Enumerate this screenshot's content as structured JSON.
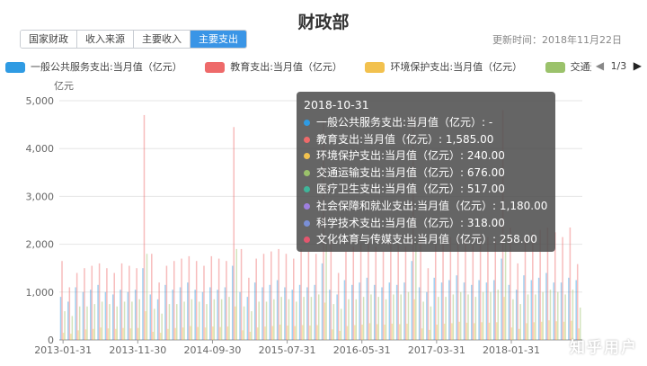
{
  "page": {
    "title": "财政部",
    "updated": "更新时间：2018年11月22日",
    "tabs": [
      {
        "label": "国家财政",
        "active": false
      },
      {
        "label": "收入来源",
        "active": false
      },
      {
        "label": "主要收入",
        "active": false
      },
      {
        "label": "主要支出",
        "active": true
      }
    ],
    "pager": "1/3",
    "unit": "亿元",
    "watermark": "知乎用户"
  },
  "chart_data": {
    "type": "bar",
    "title": "",
    "xlabel": "",
    "ylabel": "亿元",
    "ylim": [
      0,
      5000
    ],
    "yticks": [
      0,
      1000,
      2000,
      3000,
      4000,
      5000
    ],
    "ytick_labels": [
      "0",
      "1,000",
      "2,000",
      "3,000",
      "4,000",
      "5,000"
    ],
    "xtick_labels": [
      "2013-01-31",
      "2013-11-30",
      "2014-09-30",
      "2015-07-31",
      "2016-05-31",
      "2017-03-31",
      "2018-01-31"
    ],
    "x_start": "2013-01-31",
    "x_end": "2018-10-31",
    "grid": true,
    "legend_position": "top",
    "legend_visible": [
      {
        "name": "一般公共服务支出:当月值（亿元）",
        "color": "#2f9be3"
      },
      {
        "name": "教育支出:当月值（亿元）",
        "color": "#ee6a6a"
      },
      {
        "name": "环境保护支出:当月值（亿元）",
        "color": "#f2c14e"
      },
      {
        "name": "交通运输支出:当月值（亿元）",
        "color": "#9bc26b"
      }
    ],
    "series": [
      {
        "name": "一般公共服务支出:当月值（亿元）",
        "color": "#2f9be3",
        "values": [
          900,
          800,
          1100,
          1000,
          1050,
          1150,
          1000,
          950,
          1050,
          1000,
          1050,
          1500,
          950,
          850,
          1150,
          1050,
          1100,
          1200,
          1050,
          1000,
          1100,
          1050,
          1100,
          1550,
          1000,
          900,
          1200,
          1100,
          1150,
          1250,
          1100,
          1050,
          1150,
          1100,
          1150,
          1600,
          1050,
          950,
          1250,
          1150,
          1200,
          1300,
          1150,
          1100,
          1200,
          1150,
          1200,
          1650,
          1100,
          1000,
          1300,
          1200,
          1250,
          1350,
          1200,
          1150,
          1250,
          1200,
          1250,
          1700,
          1150,
          1050,
          1350,
          1250,
          1300,
          1400,
          1200,
          1200,
          1300,
          1250
        ]
      },
      {
        "name": "教育支出:当月值（亿元）",
        "color": "#ee6a6a",
        "values": [
          1650,
          1100,
          1400,
          1500,
          1550,
          1600,
          1500,
          1400,
          1600,
          1550,
          1500,
          4700,
          1800,
          1200,
          1550,
          1650,
          1700,
          1750,
          1650,
          1550,
          1750,
          1700,
          1650,
          4450,
          1900,
          1300,
          1700,
          1800,
          1850,
          1900,
          1800,
          1700,
          1900,
          1850,
          1800,
          4600,
          2050,
          1400,
          1850,
          1950,
          2000,
          2050,
          1950,
          1850,
          2050,
          2000,
          1950,
          4700,
          2200,
          1500,
          2000,
          2100,
          2150,
          2200,
          2100,
          2000,
          2200,
          2150,
          2100,
          4800,
          2350,
          1600,
          2150,
          2250,
          2300,
          2350,
          2250,
          2150,
          2350,
          1585
        ]
      },
      {
        "name": "环境保护支出:当月值（亿元）",
        "color": "#f2c14e",
        "values": [
          150,
          130,
          200,
          220,
          230,
          260,
          240,
          230,
          250,
          240,
          250,
          600,
          170,
          150,
          230,
          250,
          260,
          290,
          270,
          260,
          280,
          270,
          280,
          700,
          200,
          170,
          260,
          280,
          290,
          320,
          300,
          290,
          310,
          300,
          310,
          780,
          220,
          190,
          290,
          310,
          320,
          350,
          330,
          320,
          340,
          330,
          340,
          850,
          240,
          210,
          320,
          340,
          350,
          380,
          360,
          350,
          370,
          360,
          370,
          900,
          260,
          230,
          350,
          370,
          380,
          410,
          390,
          380,
          400,
          240
        ]
      },
      {
        "name": "交通运输支出:当月值（亿元）",
        "color": "#9bc26b",
        "values": [
          600,
          500,
          700,
          700,
          750,
          800,
          750,
          700,
          800,
          800,
          850,
          1800,
          650,
          550,
          750,
          750,
          800,
          850,
          800,
          750,
          850,
          850,
          900,
          1900,
          700,
          600,
          800,
          800,
          850,
          900,
          850,
          800,
          900,
          900,
          950,
          2000,
          750,
          650,
          850,
          850,
          900,
          950,
          900,
          850,
          950,
          950,
          1000,
          2100,
          800,
          700,
          900,
          900,
          950,
          1000,
          950,
          900,
          1000,
          1000,
          1050,
          2200,
          850,
          750,
          950,
          950,
          1000,
          1050,
          1000,
          950,
          1050,
          676
        ]
      }
    ],
    "tooltip": {
      "date": "2018-10-31",
      "rows": [
        {
          "label": "一般公共服务支出:当月值（亿元）: -",
          "color": "#2f9be3"
        },
        {
          "label": "教育支出:当月值（亿元）: 1,585.00",
          "color": "#ee6a6a"
        },
        {
          "label": "环境保护支出:当月值（亿元）: 240.00",
          "color": "#f2c14e"
        },
        {
          "label": "交通运输支出:当月值（亿元）: 676.00",
          "color": "#9bc26b"
        },
        {
          "label": "医疗卫生支出:当月值（亿元）: 517.00",
          "color": "#3fb59a"
        },
        {
          "label": "社会保障和就业支出:当月值（亿元）: 1,180.00",
          "color": "#9e7fe0"
        },
        {
          "label": "科学技术支出:当月值（亿元）: 318.00",
          "color": "#7a8fd6"
        },
        {
          "label": "文化体育与传媒支出:当月值（亿元）: 258.00",
          "color": "#e4566e"
        }
      ]
    }
  }
}
